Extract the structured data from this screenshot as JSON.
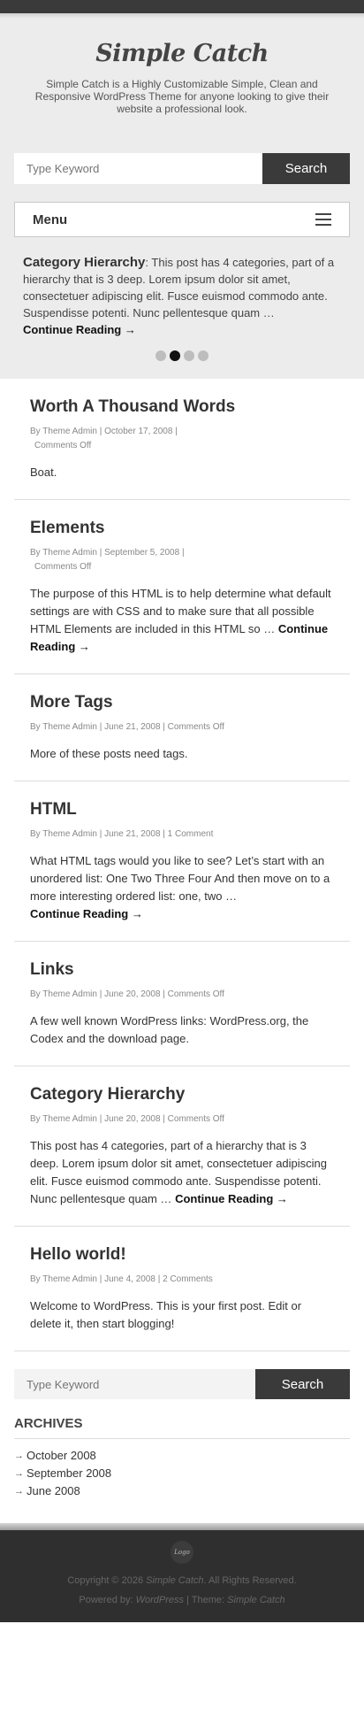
{
  "site": {
    "title": "Simple Catch",
    "description": "Simple Catch is a Highly Customizable Simple, Clean and Responsive WordPress Theme for anyone looking to give their website a professional look."
  },
  "search": {
    "placeholder": "Type Keyword",
    "button": "Search"
  },
  "menu": {
    "label": "Menu",
    "icon": "hamburger-icon"
  },
  "slider": {
    "title": "Category Hierarchy",
    "text": ": This post has 4 categories, part of a hierarchy that is 3 deep. Lorem ipsum dolor sit amet, consectetuer adipiscing elit. Fusce euismod commodo ante. Suspendisse potenti. Nunc pellentesque quam …",
    "more": "Continue Reading →",
    "active_dot": 2
  },
  "posts": [
    {
      "title": "Worth A Thousand Words",
      "meta": "By Theme Admin | October 17, 2008 |",
      "meta2": "Comments Off",
      "excerpt": "Boat.",
      "more": ""
    },
    {
      "title": "Elements",
      "meta": "By Theme Admin | September 5, 2008 |",
      "meta2": "Comments Off",
      "excerpt": "The purpose of this HTML is to help determine what default settings are with CSS and to make sure that all possible HTML Elements are included in this HTML so …",
      "more": "Continue Reading →"
    },
    {
      "title": "More Tags",
      "meta": "By Theme Admin | June 21, 2008 | Comments Off",
      "meta2": "",
      "excerpt": "More of these posts need tags.",
      "more": ""
    },
    {
      "title": "HTML",
      "meta": "By Theme Admin | June 21, 2008 | 1 Comment",
      "meta2": "",
      "excerpt": "What HTML tags would you like to see? Let’s start with an unordered list: One Two Three Four And then move on to a more interesting ordered list: one, two …",
      "more": "Continue Reading →"
    },
    {
      "title": "Links",
      "meta": "By Theme Admin | June 20, 2008 | Comments Off",
      "meta2": "",
      "excerpt": "A few well known WordPress links: WordPress.org, the Codex and the download page.",
      "more": ""
    },
    {
      "title": "Category Hierarchy",
      "meta": "By Theme Admin | June 20, 2008 | Comments Off",
      "meta2": "",
      "excerpt": "This post has 4 categories, part of a hierarchy that is 3 deep. Lorem ipsum dolor sit amet, consectetuer adipiscing elit. Fusce euismod commodo ante. Suspendisse potenti. Nunc pellentesque quam …",
      "more": "Continue Reading →"
    },
    {
      "title": "Hello world!",
      "meta": "By Theme Admin | June 4, 2008 | 2 Comments",
      "meta2": "",
      "excerpt": "Welcome to WordPress. This is your first post. Edit or delete it, then start blogging!",
      "more": ""
    }
  ],
  "archives": {
    "title": "ARCHIVES",
    "items": [
      "October 2008",
      "September 2008",
      "June 2008"
    ]
  },
  "footer": {
    "logo": "Logo",
    "copyright_prefix": "Copyright © 2026",
    "copyright_site": "Simple Catch",
    "copyright_suffix": ". All Rights Reserved.",
    "powered_prefix": "Powered by:",
    "powered_wp": "WordPress",
    "theme_prefix": "| Theme:",
    "theme_name": "Simple Catch"
  }
}
